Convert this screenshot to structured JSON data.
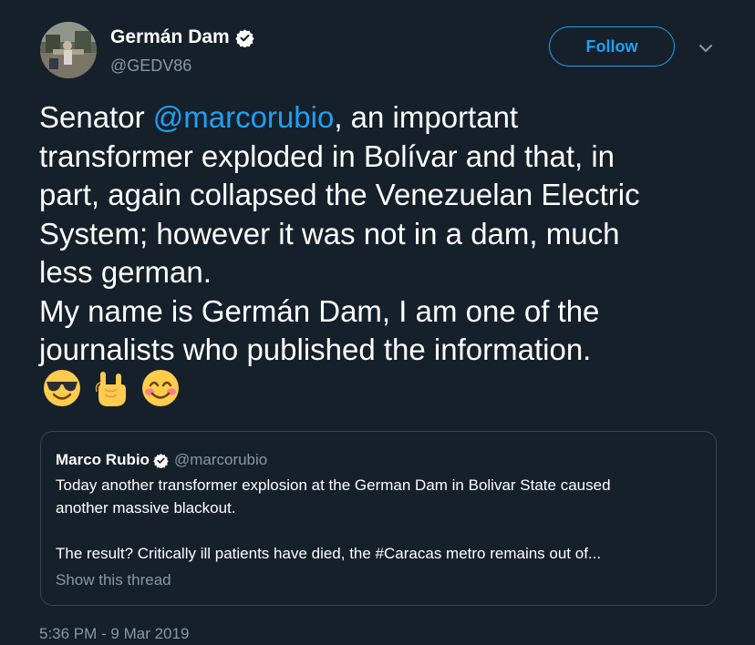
{
  "author": {
    "name": "Germán Dam",
    "handle": "@GEDV86",
    "verified": true
  },
  "follow_label": "Follow",
  "colors": {
    "background": "#15202b",
    "accent": "#1da1f2",
    "muted": "#8899a6",
    "border": "#38444d"
  },
  "tweet": {
    "line1_prefix": "Senator ",
    "line1_mention": "@marcorubio",
    "line1_suffix": ", an important",
    "line2": "transformer exploded in Bolívar and that, in",
    "line3": "part, again collapsed the Venezuelan Electric",
    "line4": "System; however it was not in a dam, much",
    "line5": "less german.",
    "line6": "My name is Germán Dam, I am one of the",
    "line7": "journalists who published the information.",
    "emojis": [
      "smiling-face-with-sunglasses-icon",
      "sign-of-the-horns-icon",
      "smiling-face-with-smiling-eyes-icon"
    ]
  },
  "quoted": {
    "name": "Marco Rubio",
    "handle": "@marcorubio",
    "verified": true,
    "line1": "Today another transformer explosion at the German Dam in Bolivar State caused",
    "line2": "another massive blackout.",
    "line3": "",
    "line4": "The result? Critically ill patients have died, the #Caracas metro remains out of...",
    "show_thread": "Show this thread"
  },
  "timestamp": "5:36 PM - 9 Mar 2019"
}
